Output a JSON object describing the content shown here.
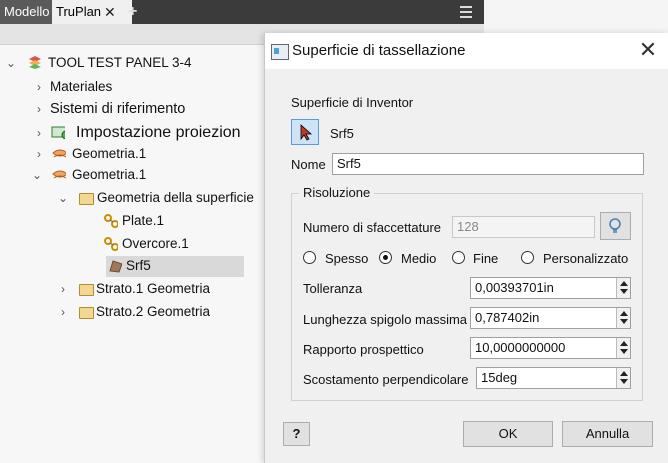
{
  "tabs": {
    "modello": "Modello",
    "truplan": "TruPlan",
    "close_glyph": "✕",
    "add_glyph": "+"
  },
  "tree": {
    "root": "TOOL TEST PANEL 3-4",
    "materiales": "Materiales",
    "sistemi": "Sistemi di riferimento",
    "impostazione": "Impostazione proiezion",
    "geometria1a": "Geometria.1",
    "geometria1b": "Geometria.1",
    "geom_superficie": "Geometria della superficie",
    "plate": "Plate.1",
    "overcore": "Overcore.1",
    "srf5": "Srf5",
    "strato1": "Strato.1 Geometria",
    "strato2": "Strato.2 Geometria"
  },
  "dialog": {
    "title": "Superficie di tassellazione",
    "close_glyph": "✕",
    "inventor_label": "Superficie di Inventor",
    "selected_surface": "Srf5",
    "nome_label": "Nome",
    "nome_value": "Srf5",
    "risoluzione_label": "Risoluzione",
    "sfaccettature_label": "Numero di sfaccettature",
    "sfaccettature_value": "128",
    "radio": {
      "spesso": "Spesso",
      "medio": "Medio",
      "fine": "Fine",
      "personalizzato": "Personalizzato",
      "selected": "medio"
    },
    "tolleranza_label": "Tolleranza",
    "tolleranza_value": "0,00393701in",
    "spigolo_label": "Lunghezza spigolo massima",
    "spigolo_value": "0,787402in",
    "rapporto_label": "Rapporto prospettico",
    "rapporto_value": "10,0000000000",
    "scostamento_label": "Scostamento perpendicolare",
    "scostamento_value": "15deg",
    "ok_label": "OK",
    "annulla_label": "Annulla",
    "help_glyph": "?"
  },
  "colors": {
    "tabbar": "#3b3b3b",
    "accent": "#5b9bd5",
    "selection": "#d9d9d9"
  }
}
